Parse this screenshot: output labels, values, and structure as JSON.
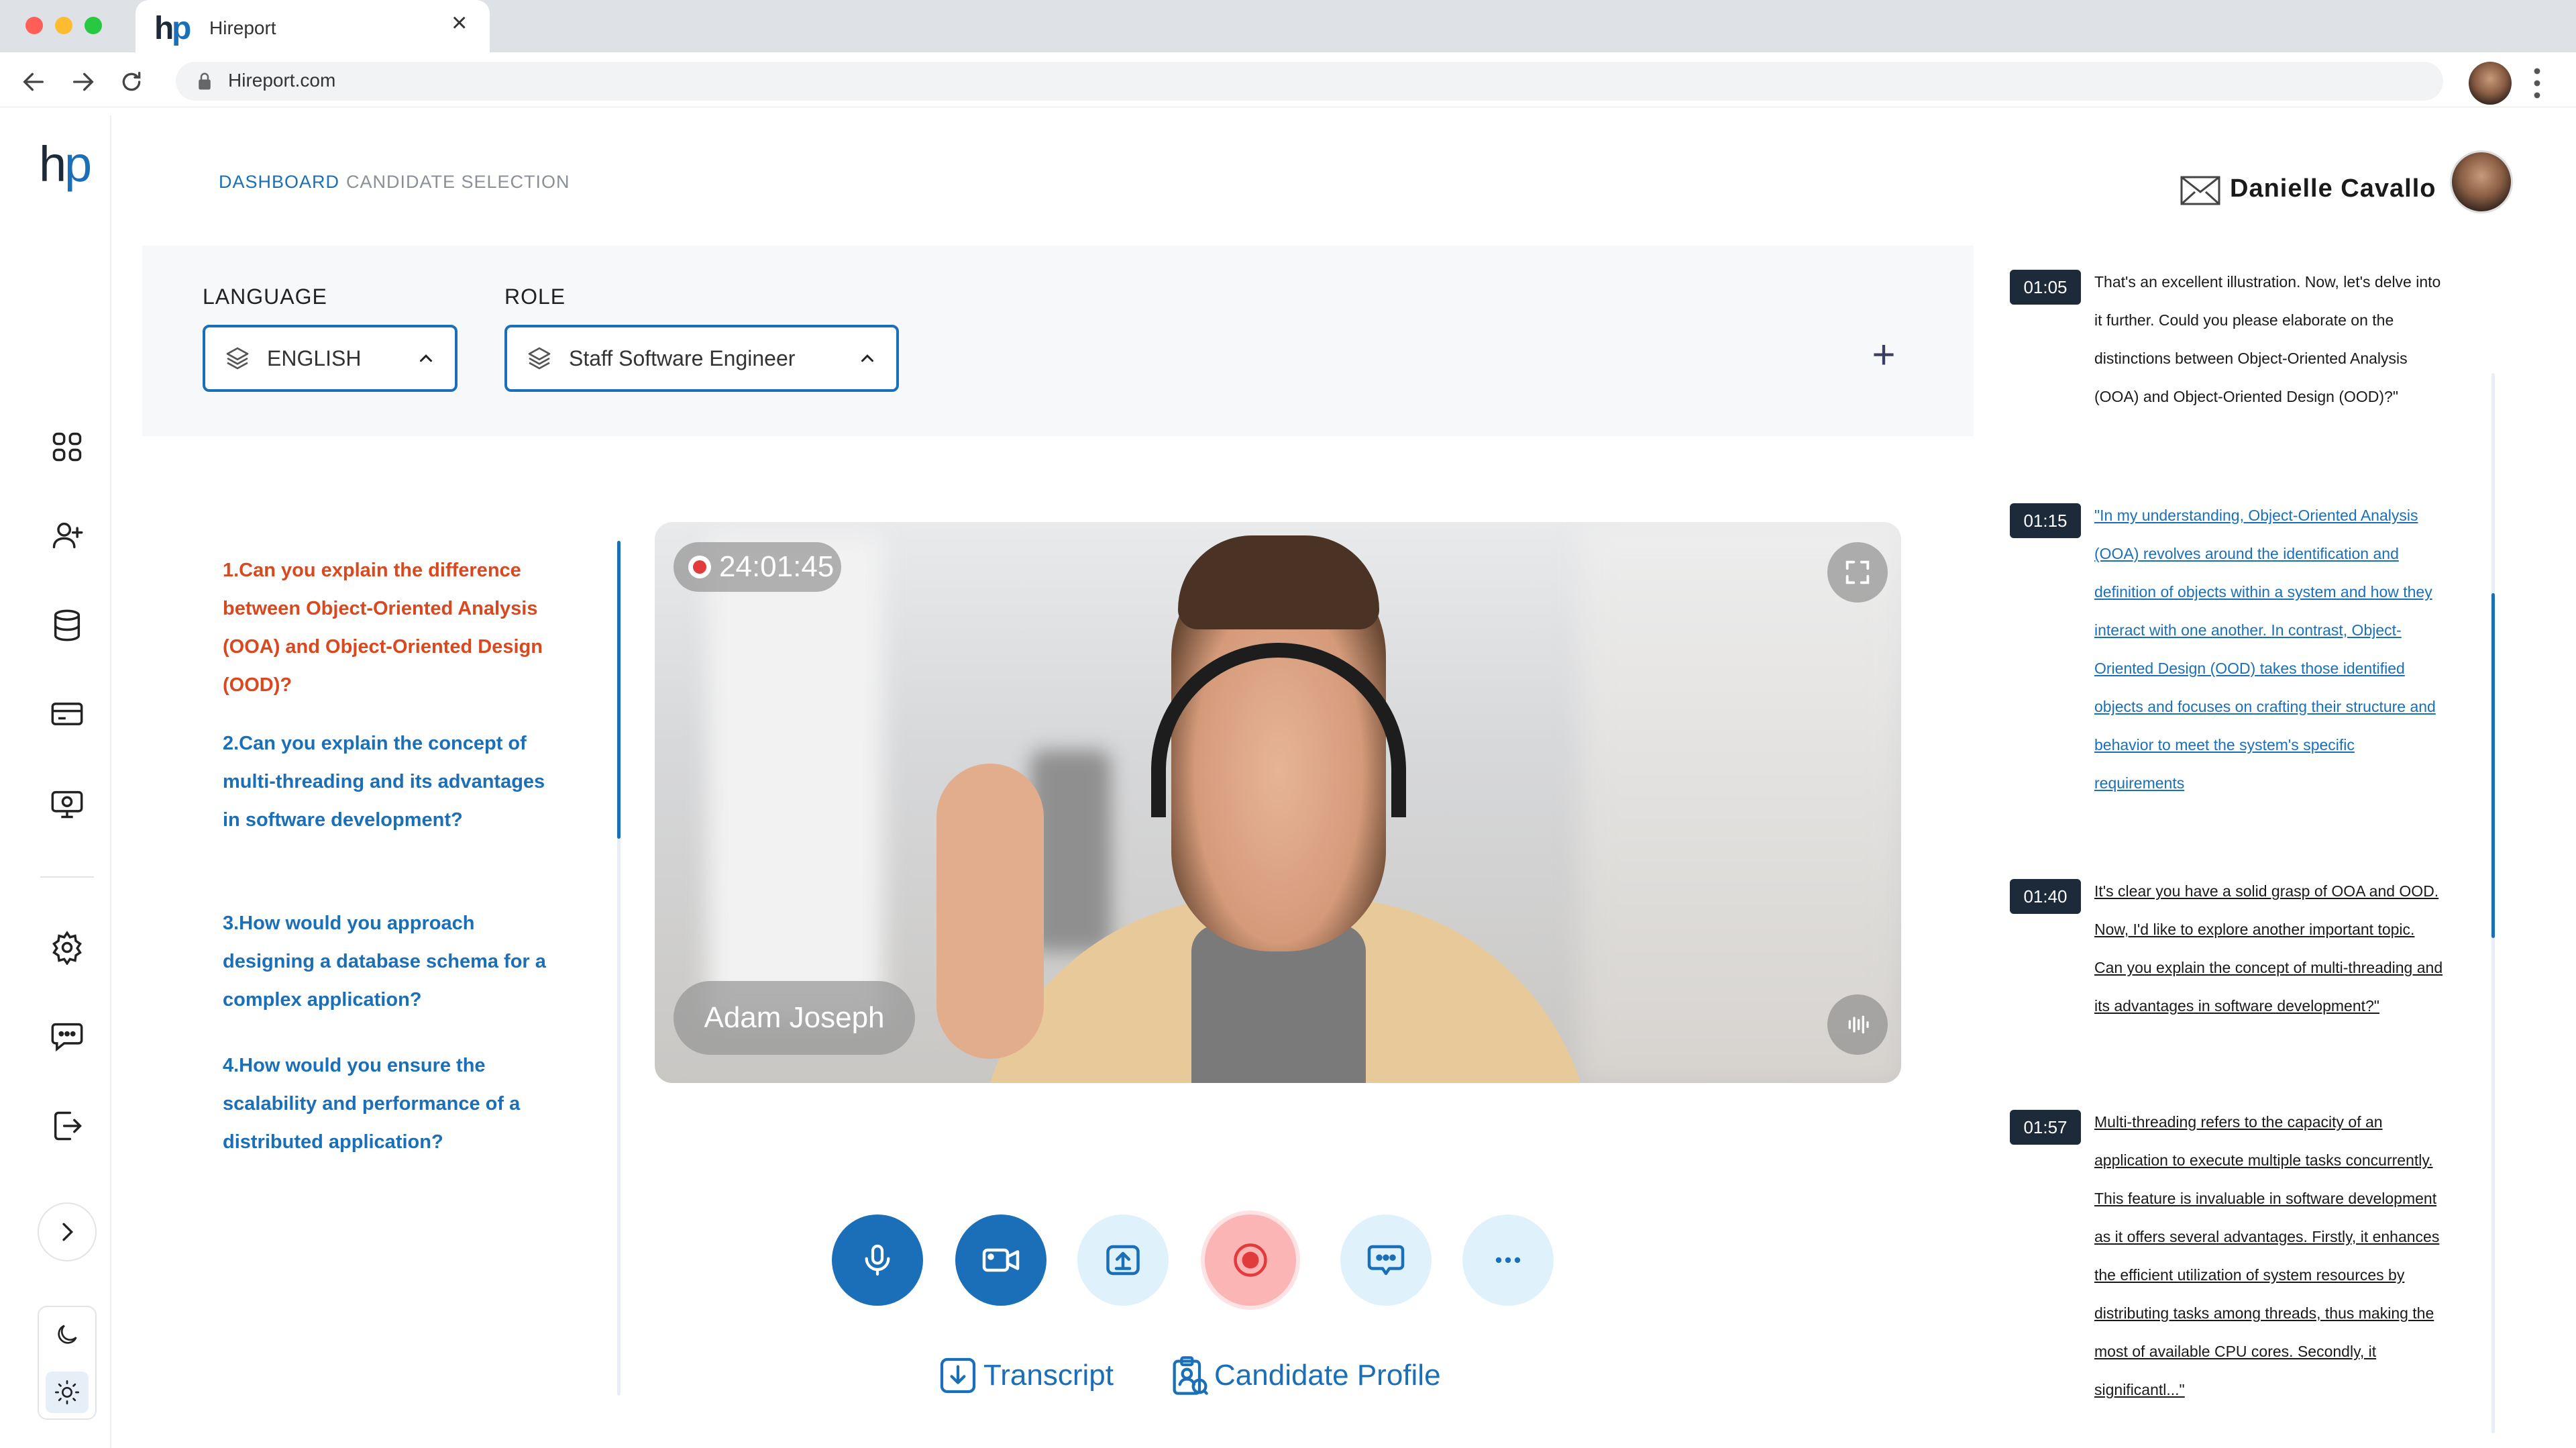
{
  "browser": {
    "tab_title": "Hireport",
    "tab_close": "×",
    "url": "Hireport.com"
  },
  "brand": {
    "logo_text": "hp"
  },
  "breadcrumb": {
    "items": [
      "DASHBOARD",
      "CANDIDATE SELECTION"
    ]
  },
  "user": {
    "name": "Danielle  Cavallo"
  },
  "filters": {
    "language_label": "LANGUAGE",
    "language_value": "ENGLISH",
    "role_label": "ROLE",
    "role_value": "Staff Software Engineer",
    "add_label": "+"
  },
  "questions": [
    "1.Can you explain the difference between Object-Oriented Analysis (OOA) and Object-Oriented Design (OOD)?",
    "2.Can you explain the concept of multi-threading and its advantages in software development?",
    "3.How would you approach designing a database schema for a complex application?",
    "4.How would you ensure the scalability and performance of a distributed application?"
  ],
  "video": {
    "timer": "24:01:45",
    "candidate_name": "Adam Joseph"
  },
  "links": {
    "transcript": "Transcript",
    "candidate_profile": "Candidate Profile"
  },
  "transcript": [
    {
      "time": "01:05",
      "text": "That's an excellent illustration. Now, let's delve into it further. Could you please elaborate on the distinctions between Object-Oriented Analysis (OOA) and Object-Oriented Design (OOD)?\""
    },
    {
      "time": "01:15",
      "text": "\"In my understanding, Object-Oriented Analysis (OOA) revolves around the identification and definition of objects within a system and how they interact with one another. In contrast, Object-Oriented Design (OOD) takes those identified objects and focuses on crafting their structure and behavior to meet the system's specific requirements"
    },
    {
      "time": "01:40",
      "text": "It's clear you have a solid grasp of OOA and OOD. Now, I'd like to explore another important topic. Can you explain the concept of multi-threading and its advantages in software development?\""
    },
    {
      "time": "01:57",
      "text": "Multi-threading refers to the capacity of an application to execute multiple tasks concurrently. This feature is invaluable in software development as it offers several advantages. Firstly, it enhances the efficient utilization of system resources by distributing tasks among threads, thus making the most of available CPU cores. Secondly, it significantl...\""
    }
  ],
  "colors": {
    "accent": "#1b6fb8",
    "active_question": "#d9481e",
    "record": "#e23b3b",
    "badge_bg": "#1d2a3a"
  }
}
